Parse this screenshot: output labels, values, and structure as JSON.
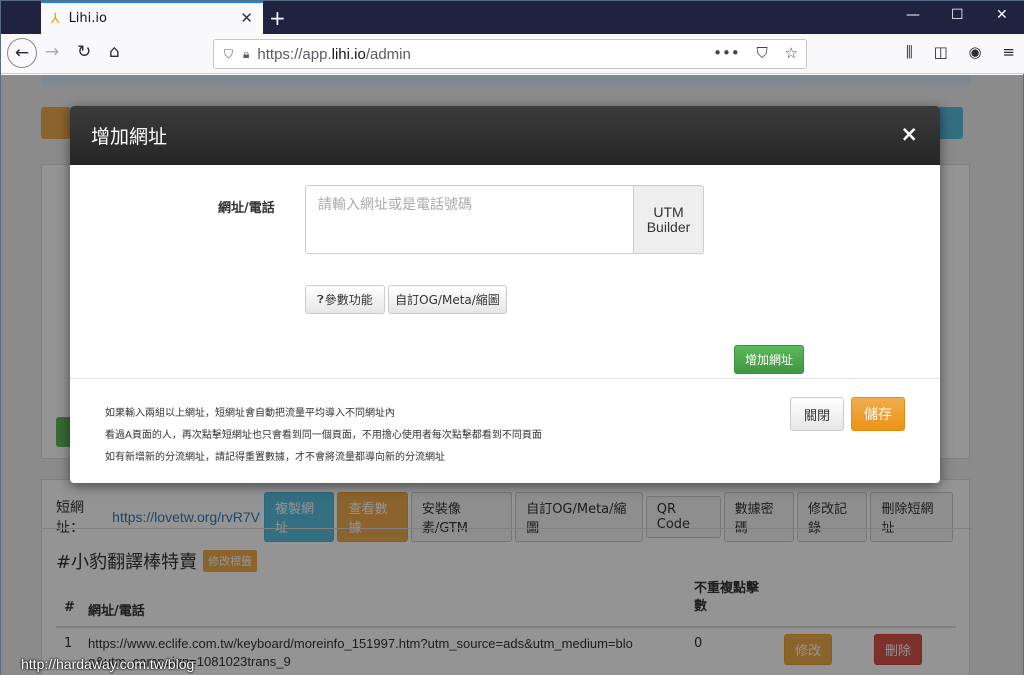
{
  "browser": {
    "tab_title": "Lihi.io",
    "url_prefix": "https://app.",
    "url_domain": "lihi.io",
    "url_path": "/admin"
  },
  "page": {
    "short_url_label": "短網址：",
    "short_url": "https://lovetw.org/rvR7V",
    "buttons": {
      "copy": "複製網址",
      "view_data": "查看數據",
      "pixel": "安裝像素/GTM",
      "og": "自訂OG/Meta/縮圖",
      "qr": "QR Code",
      "data_password": "數據密碼",
      "edit_log": "修改記錄",
      "delete_short": "刪除短網址"
    },
    "title": "#小豹翻譯棒特賣",
    "edit_tag": "修改標籤",
    "table_headers": {
      "num": "#",
      "url": "網址/電話",
      "unique_clicks": "不重複點擊數"
    },
    "row": {
      "num": "1",
      "url_line1": "https://www.eclife.com.tw/keyboard/moreinfo_151997.htm?utm_source=ads&utm_medium=blo",
      "url_line2": "g&utm_campaign=1081023trans_9",
      "clicks": "0",
      "edit": "修改",
      "delete": "刪除"
    }
  },
  "modal": {
    "title": "增加網址",
    "close_symbol": "×",
    "field_label": "網址/電話",
    "placeholder": "請輸入網址或是電話號碼",
    "utm_line1": "UTM",
    "utm_line2": "Builder",
    "params_button": "參數功能",
    "og_button": "自訂OG/Meta/縮圖",
    "add_url_button": "增加網址",
    "notes": [
      "如果輸入兩組以上網址，短網址會自動把流量平均導入不同網址內",
      "看過A頁面的人，再次點擊短網址也只會看到同一個頁面，不用擔心使用者每次點擊都看到不同頁面",
      "如有新增新的分流網址，請記得重置數據，才不會將流量都導向新的分流網址"
    ],
    "close_button": "關閉",
    "save_button": "儲存"
  },
  "watermark": "http://hardaway.com.tw/blog"
}
